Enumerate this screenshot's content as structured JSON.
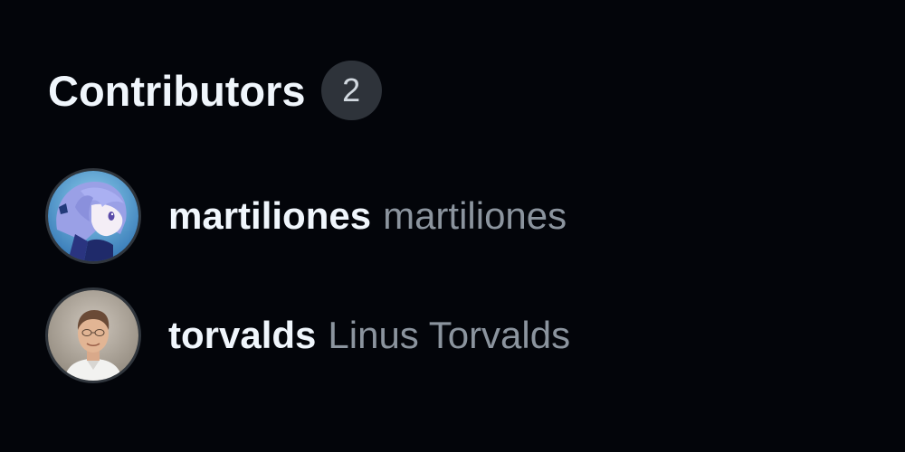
{
  "header": {
    "title": "Contributors",
    "count": "2"
  },
  "contributors": [
    {
      "login": "martiliones",
      "name": "martiliones",
      "avatar_icon": "anime-avatar-icon"
    },
    {
      "login": "torvalds",
      "name": "Linus Torvalds",
      "avatar_icon": "person-photo-avatar-icon"
    }
  ],
  "colors": {
    "background": "#03050a",
    "title": "#f0f6fc",
    "badge_bg": "#2e333a",
    "muted_text": "#8b949e"
  }
}
